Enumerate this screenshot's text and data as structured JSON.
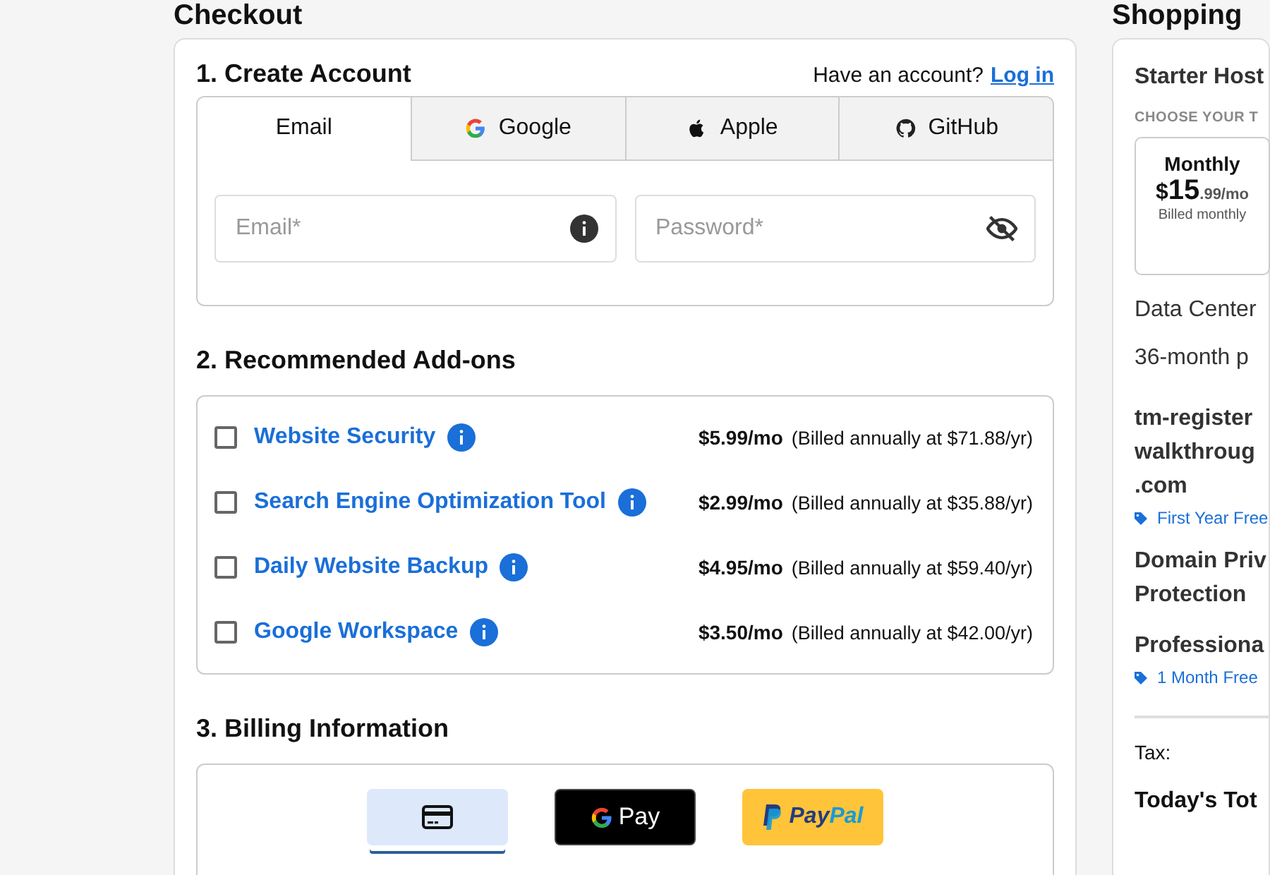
{
  "checkout": {
    "title": "Checkout",
    "account": {
      "heading": "1. Create Account",
      "prompt": "Have an account?",
      "login_link": "Log in",
      "tabs": [
        {
          "label": "Email",
          "kind": "email",
          "selected": true
        },
        {
          "label": "Google",
          "kind": "google",
          "selected": false
        },
        {
          "label": "Apple",
          "kind": "apple",
          "selected": false
        },
        {
          "label": "GitHub",
          "kind": "github",
          "selected": false
        }
      ],
      "email": {
        "placeholder": "Email*"
      },
      "password": {
        "placeholder": "Password*"
      }
    },
    "addons": {
      "heading": "2. Recommended Add-ons",
      "items": [
        {
          "name": "Website Security",
          "price": "$5.99/mo",
          "billing": "(Billed annually at $71.88/yr)",
          "checked": false
        },
        {
          "name": "Search Engine Optimization Tool",
          "price": "$2.99/mo",
          "billing": "(Billed annually at $35.88/yr)",
          "checked": false
        },
        {
          "name": "Daily Website Backup",
          "price": "$4.95/mo",
          "billing": "(Billed annually at $59.40/yr)",
          "checked": false
        },
        {
          "name": "Google Workspace",
          "price": "$3.50/mo",
          "billing": "(Billed annually at $42.00/yr)",
          "checked": false
        }
      ]
    },
    "billing": {
      "heading": "3. Billing Information",
      "methods": [
        {
          "kind": "card",
          "selected": true
        },
        {
          "kind": "gpay",
          "label": "Pay",
          "selected": false
        },
        {
          "kind": "paypal",
          "label_1": "Pay",
          "label_2": "Pal",
          "selected": false
        }
      ]
    }
  },
  "cart": {
    "title": "Shopping",
    "plan": "Starter Host",
    "term_label": "CHOOSE YOUR T",
    "term": {
      "name": "Monthly",
      "currency": "$",
      "amount": "15",
      "cents": ".99/mo",
      "note": "Billed monthly",
      "selected": false
    },
    "lines": [
      "Data Center",
      "36-month p"
    ],
    "items": [
      {
        "name": [
          "tm-register",
          "walkthroug",
          ".com"
        ],
        "promo": "First Year Free"
      },
      {
        "name": [
          "Domain Priv",
          "Protection"
        ]
      },
      {
        "name": [
          "Professiona"
        ],
        "promo": "1 Month Free"
      }
    ],
    "tax": "Tax:",
    "total": "Today's Tot"
  }
}
